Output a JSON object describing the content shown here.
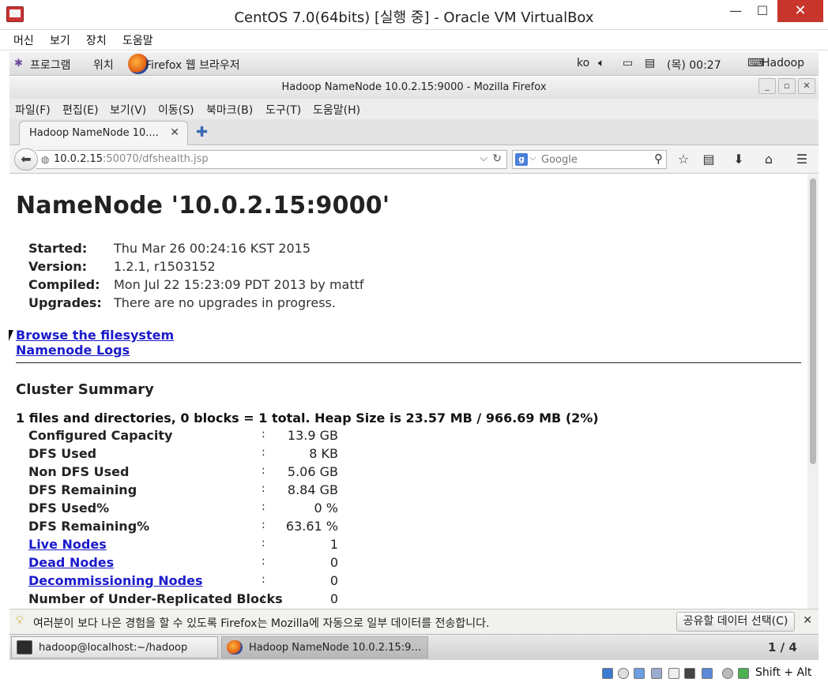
{
  "vbox": {
    "title": "CentOS 7.0(64bits) [실행 중] - Oracle VM VirtualBox",
    "minimize_glyph": "—",
    "maximize_glyph": "☐",
    "close_glyph": "✕",
    "menu": [
      "머신",
      "보기",
      "장치",
      "도움말"
    ],
    "host_key": "Shift + Alt"
  },
  "panel": {
    "applications": "프로그램",
    "places": "위치",
    "active_app": "Firefox 웹 브라우저",
    "lang": "ko",
    "clock": "(목) 00:27",
    "user": "Hadoop"
  },
  "firefox": {
    "window_title": "Hadoop NameNode 10.0.2.15:9000 - Mozilla Firefox",
    "menu": [
      "파일(F)",
      "편집(E)",
      "보기(V)",
      "이동(S)",
      "북마크(B)",
      "도구(T)",
      "도움말(H)"
    ],
    "tab_title": "Hadoop NameNode 10....",
    "url_host": "10.0.2.15",
    "url_rest": ":50070/dfshealth.jsp",
    "search_placeholder": "Google"
  },
  "page": {
    "title": "NameNode '10.0.2.15:9000'",
    "info": [
      {
        "k": "Started:",
        "v": "Thu Mar 26 00:24:16 KST 2015"
      },
      {
        "k": "Version:",
        "v": "1.2.1, r1503152"
      },
      {
        "k": "Compiled:",
        "v": "Mon Jul 22 15:23:09 PDT 2013 by mattf"
      },
      {
        "k": "Upgrades:",
        "v": "There are no upgrades in progress."
      }
    ],
    "links": [
      "Browse the filesystem",
      "Namenode Logs"
    ],
    "cluster_title": "Cluster Summary",
    "cluster_line": "1 files and directories, 0 blocks = 1 total. Heap Size is 23.57 MB / 966.69 MB (2%)",
    "rows": [
      {
        "k": "Configured Capacity",
        "v": "13.9 GB"
      },
      {
        "k": "DFS Used",
        "v": "8 KB"
      },
      {
        "k": "Non DFS Used",
        "v": "5.06 GB"
      },
      {
        "k": "DFS Remaining",
        "v": "8.84 GB"
      },
      {
        "k": "DFS Used%",
        "v": "0 %"
      },
      {
        "k": "DFS Remaining%",
        "v": "63.61 %"
      },
      {
        "k": "Live Nodes",
        "v": "1"
      },
      {
        "k": "Dead Nodes",
        "v": "0"
      },
      {
        "k": "Decommissioning Nodes",
        "v": "0"
      },
      {
        "k": "Number of Under-Replicated Blocks",
        "v": "0"
      }
    ],
    "colon": ":"
  },
  "notification": {
    "message": "여러분이 보다 나은 경험을 할 수 있도록 Firefox는 Mozilla에 자동으로 일부 데이터를 전송합니다.",
    "button": "공유할 데이터 선택(C)"
  },
  "taskbar": {
    "terminal": "hadoop@localhost:~/hadoop",
    "firefox": "Hadoop NameNode 10.0.2.15:9…",
    "workspace": "1 / 4"
  }
}
